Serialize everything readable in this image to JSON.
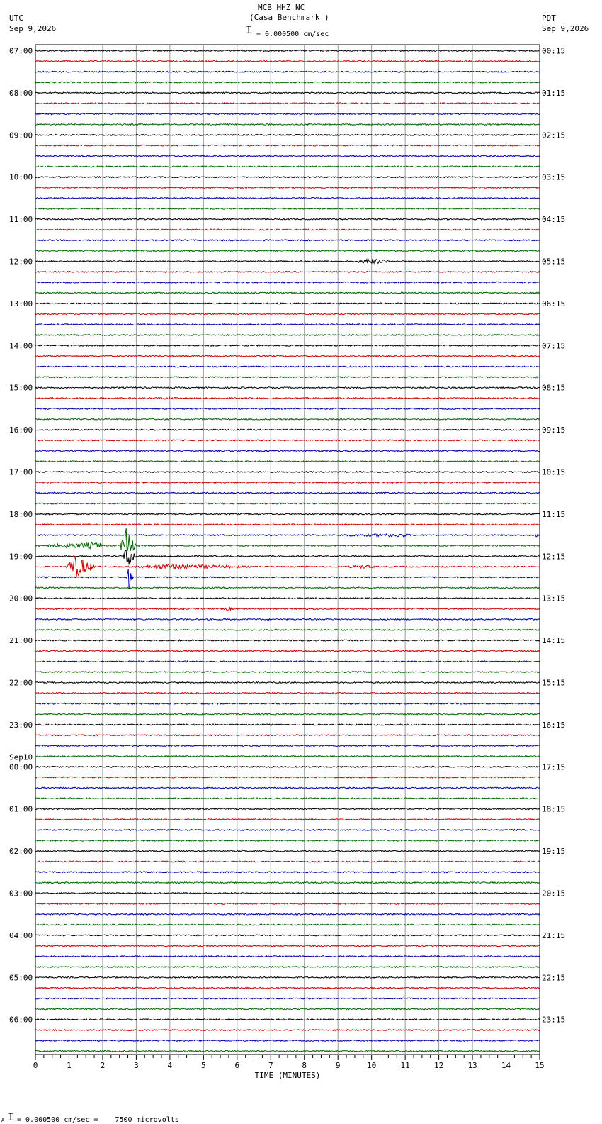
{
  "header": {
    "station": "MCB HHZ NC",
    "location": "(Casa Benchmark )",
    "left_zone": "UTC",
    "left_date": "Sep 9,2026",
    "right_zone": "PDT",
    "right_date": "Sep 9,2026",
    "scale_text": "= 0.000500 cm/sec"
  },
  "footer": {
    "scale_text": "= 0.000500 cm/sec =    7500 microvolts",
    "prefix": "A"
  },
  "colors": {
    "trace_cycle": [
      "#000000",
      "#cc0000",
      "#0000aa",
      "#006600"
    ],
    "grid": "#999999"
  },
  "chart_data": {
    "type": "line",
    "title": "MCB HHZ NC (Casa Benchmark )",
    "xlabel": "TIME (MINUTES)",
    "ylabel": "",
    "xlim": [
      0,
      15
    ],
    "x_ticks": [
      "0",
      "1",
      "2",
      "3",
      "4",
      "5",
      "6",
      "7",
      "8",
      "9",
      "10",
      "11",
      "12",
      "13",
      "14",
      "15"
    ],
    "traces_per_hour": 4,
    "trace_minutes": 15,
    "grid": true,
    "date_break": {
      "label": "Sep10",
      "before_hour_label": "00:00"
    },
    "left_hour_labels": [
      "07:00",
      "08:00",
      "09:00",
      "10:00",
      "11:00",
      "12:00",
      "13:00",
      "14:00",
      "15:00",
      "16:00",
      "17:00",
      "18:00",
      "19:00",
      "20:00",
      "21:00",
      "22:00",
      "23:00",
      "00:00",
      "01:00",
      "02:00",
      "03:00",
      "04:00",
      "05:00",
      "06:00"
    ],
    "right_hour_labels": [
      "00:15",
      "01:15",
      "02:15",
      "03:15",
      "04:15",
      "05:15",
      "06:15",
      "07:15",
      "08:15",
      "09:15",
      "10:15",
      "11:15",
      "12:15",
      "13:15",
      "14:15",
      "15:15",
      "16:15",
      "17:15",
      "18:15",
      "19:15",
      "20:15",
      "21:15",
      "22:15",
      "23:15"
    ],
    "events": [
      {
        "trace": 20,
        "start_min": 9.5,
        "end_min": 10.6,
        "peak_min": 9.95,
        "amplitude": 3.5
      },
      {
        "trace": 33,
        "start_min": 3.7,
        "end_min": 4.2,
        "peak_min": 3.9,
        "amplitude": 1.6
      },
      {
        "trace": 42,
        "start_min": 10.3,
        "end_min": 10.5,
        "peak_min": 10.4,
        "amplitude": 1.5
      },
      {
        "trace": 46,
        "start_min": 8.8,
        "end_min": 11.2,
        "peak_min": 10.9,
        "amplitude": 1.8
      },
      {
        "trace": 46,
        "start_min": 14.8,
        "end_min": 15.0,
        "peak_min": 14.9,
        "amplitude": 2.0
      },
      {
        "trace": 47,
        "start_min": 0.0,
        "end_min": 2.0,
        "peak_min": 1.9,
        "amplitude": 4.0
      },
      {
        "trace": 47,
        "start_min": 2.5,
        "end_min": 3.0,
        "peak_min": 2.7,
        "amplitude": 24.0
      },
      {
        "trace": 48,
        "start_min": 2.6,
        "end_min": 3.0,
        "peak_min": 2.75,
        "amplitude": 18.0
      },
      {
        "trace": 49,
        "start_min": 0.9,
        "end_min": 1.8,
        "peak_min": 1.2,
        "amplitude": 16.0
      },
      {
        "trace": 49,
        "start_min": 2.9,
        "end_min": 6.5,
        "peak_min": 3.9,
        "amplitude": 3.0
      },
      {
        "trace": 49,
        "start_min": 9.2,
        "end_min": 10.2,
        "peak_min": 9.8,
        "amplitude": 1.8
      },
      {
        "trace": 50,
        "start_min": 2.7,
        "end_min": 2.9,
        "peak_min": 2.75,
        "amplitude": 22.0
      },
      {
        "trace": 53,
        "start_min": 5.6,
        "end_min": 5.9,
        "peak_min": 5.7,
        "amplitude": 1.8
      }
    ]
  }
}
